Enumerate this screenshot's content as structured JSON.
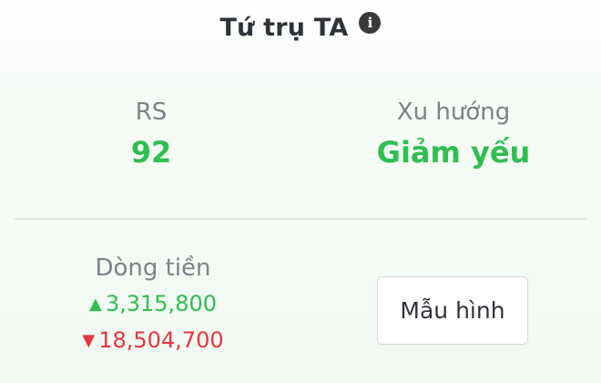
{
  "header": {
    "title": "Tứ trụ TA",
    "info_icon": "info-icon"
  },
  "metrics": {
    "rs": {
      "label": "RS",
      "value": "92"
    },
    "trend": {
      "label": "Xu hướng",
      "value": "Giảm yếu"
    }
  },
  "cashflow": {
    "label": "Dòng tiền",
    "inflow": "3,315,800",
    "outflow": "18,504,700",
    "inflow_arrow": "▲",
    "outflow_arrow": "▼"
  },
  "pattern_button": {
    "label": "Mẫu hình"
  },
  "colors": {
    "positive": "#2fbf4f",
    "negative": "#e8343e",
    "muted": "#7d8288",
    "text": "#2f3338"
  }
}
